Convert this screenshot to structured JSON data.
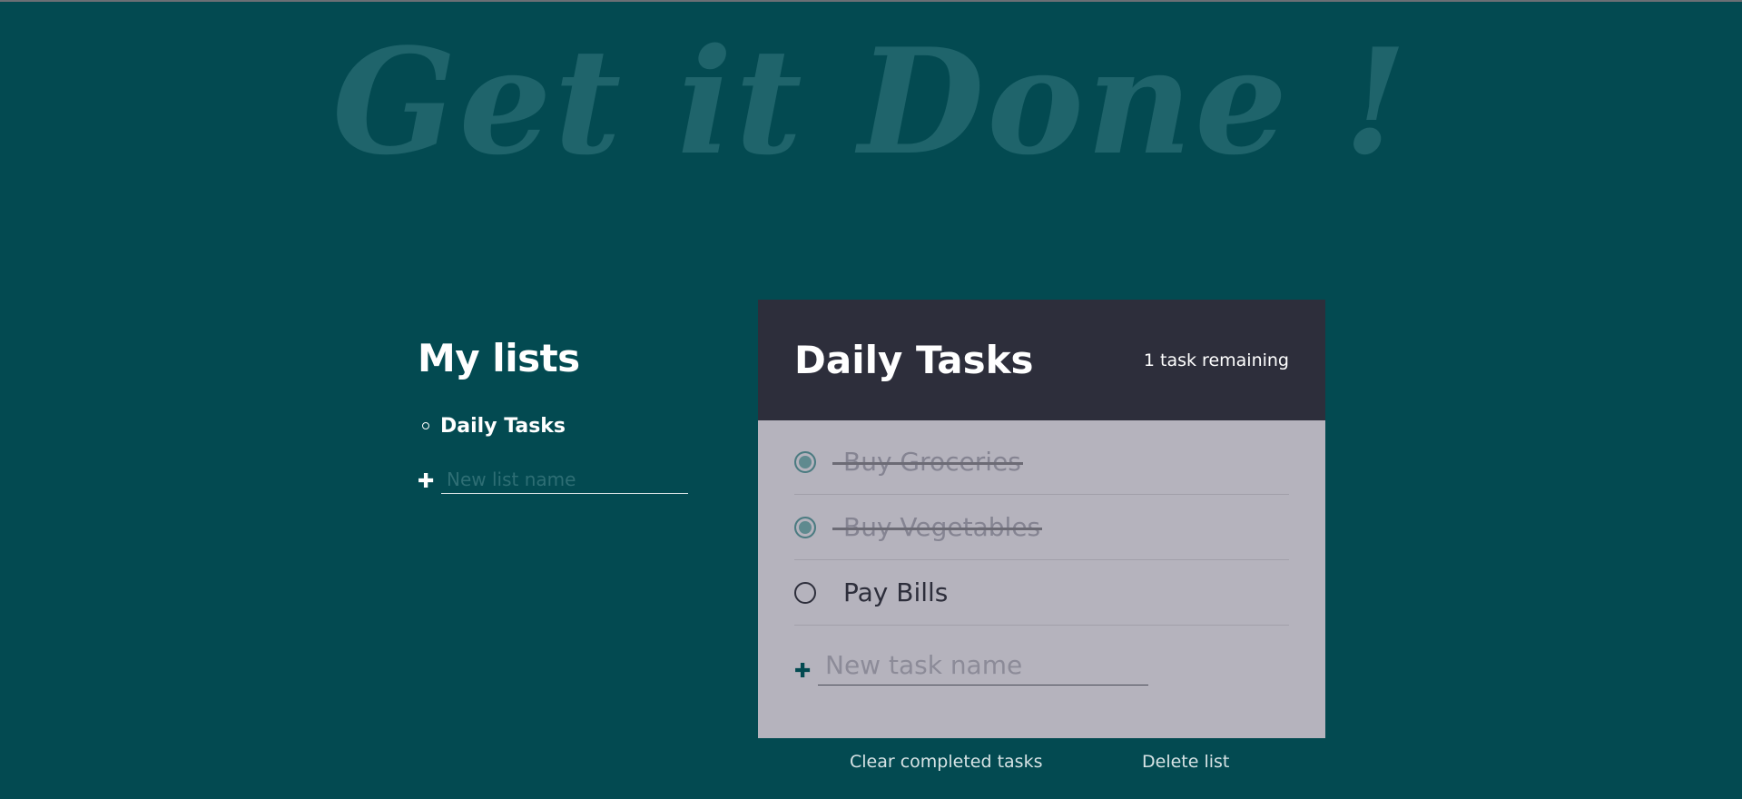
{
  "app": {
    "title": "Get it Done !"
  },
  "colors": {
    "background": "#034a51",
    "header_bg": "#2d2e3b",
    "body_bg": "#b5b3bd",
    "title_color": "#1f646b"
  },
  "lists_panel": {
    "title": "My lists",
    "items": [
      {
        "label": "Daily Tasks",
        "active": true
      }
    ],
    "new_list": {
      "icon": "plus-icon",
      "placeholder": "New list name",
      "value": ""
    }
  },
  "tasks_card": {
    "title": "Daily Tasks",
    "count_text": "1 task remaining",
    "tasks": [
      {
        "label": "Buy Groceries",
        "completed": true
      },
      {
        "label": "Buy Vegetables",
        "completed": true
      },
      {
        "label": "Pay Bills",
        "completed": false
      }
    ],
    "new_task": {
      "icon": "plus-icon",
      "placeholder": "New task name",
      "value": ""
    }
  },
  "footer": {
    "clear_label": "Clear completed tasks",
    "delete_label": "Delete list"
  }
}
